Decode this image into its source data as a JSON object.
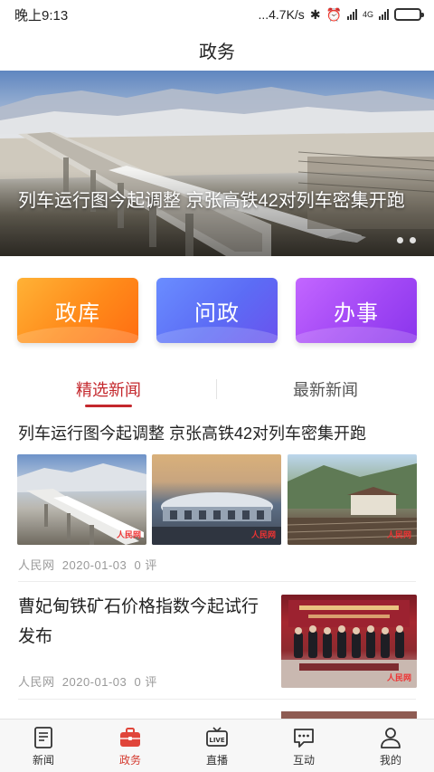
{
  "status_bar": {
    "time": "晚上9:13",
    "speed": "...4.7K/s",
    "network": "4G"
  },
  "header": {
    "title": "政务"
  },
  "banner": {
    "caption": "列车运行图今起调整 京张高铁42对列车密集开跑",
    "pages": 2
  },
  "quick_actions": [
    {
      "label": "政库",
      "color": "#ff8a1a"
    },
    {
      "label": "问政",
      "color": "#5c6cf5"
    },
    {
      "label": "办事",
      "color": "#a248f5"
    }
  ],
  "news_tabs": [
    {
      "label": "精选新闻",
      "active": true
    },
    {
      "label": "最新新闻",
      "active": false
    }
  ],
  "news": [
    {
      "title": "列车运行图今起调整 京张高铁42对列车密集开跑",
      "source": "人民网",
      "date": "2020-01-03",
      "comments": "0 评"
    },
    {
      "title": "曹妃甸铁矿石价格指数今起试行发布",
      "source": "人民网",
      "date": "2020-01-03",
      "comments": "0 评"
    }
  ],
  "tab_bar": [
    {
      "label": "新闻",
      "icon": "newspaper-icon"
    },
    {
      "label": "政务",
      "icon": "briefcase-icon",
      "active": true
    },
    {
      "label": "直播",
      "icon": "live-tv-icon"
    },
    {
      "label": "互动",
      "icon": "chat-icon"
    },
    {
      "label": "我的",
      "icon": "user-icon"
    }
  ],
  "colors": {
    "accent": "#c4282d",
    "tab_active": "#d43a2f"
  }
}
